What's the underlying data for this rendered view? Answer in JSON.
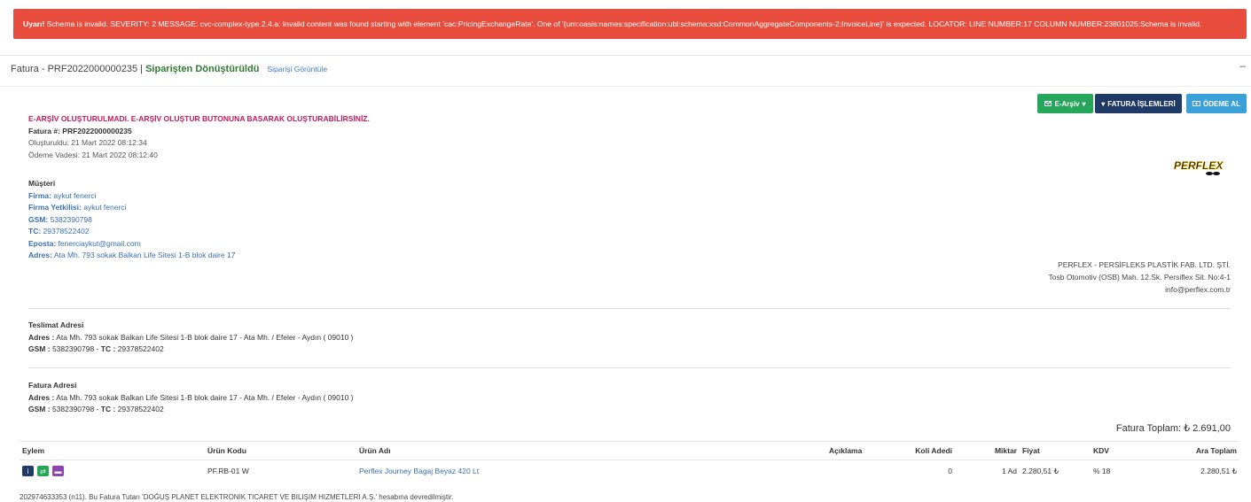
{
  "alert": {
    "prefix": "Uyarı!",
    "message": " Schema is invalid. SEVERITY: 2 MESSAGE: cvc-complex-type.2.4.a: Invalid content was found starting with element 'cac:PricingExchangeRate'. One of '{urn:oasis:names:specification:ubl:schema:xsd:CommonAggregateComponents-2:InvoiceLine}' is expected. LOCATOR: LINE NUMBER:17 COLUMN NUMBER:23801025:Schema is invalid.",
    "close": "×"
  },
  "header": {
    "title": "Fatura - PRF2022000000235 |",
    "status": "Siparişten Dönüştürüldü",
    "link": "Siparişi Görüntüle",
    "collapse": "–"
  },
  "buttons": {
    "earsiv": "E-Arşiv",
    "fatura_islemleri": "FATURA İŞLEMLERİ",
    "odeme_al": "ÖDEME AL"
  },
  "invoice": {
    "warning": "E-ARŞİV OLUŞTURULMADI. E-ARŞİV OLUŞTUR BUTONUNA BASARAK OLUŞTURABİLİRSİNİZ.",
    "number_label": "Fatura #:",
    "number": "PRF2022000000235",
    "created": "Oluşturuldu: 21 Mart 2022 08:12:34",
    "due": "Ödeme Vadesi: 21 Mart 2022 08:12:40"
  },
  "customer": {
    "heading": "Müşteri",
    "firma_label": "Firma:",
    "firma": "aykut fenerci",
    "yetkili_label": "Firma Yetkilisi:",
    "yetkili": "aykut fenerci",
    "gsm_label": "GSM:",
    "gsm": "5382390798",
    "tc_label": "TC:",
    "tc": "29378522402",
    "eposta_label": "Eposta:",
    "eposta": "fenerciaykut@gmail.com",
    "adres_label": "Adres:",
    "adres": "Ata Mh. 793 sokak Balkan Life Sitesi 1-B blok daire 17"
  },
  "logo_text": "PERFLEX",
  "company": {
    "name": "PERFLEX - PERSİFLEKS PLASTİK FAB. LTD. ŞTİ.",
    "address": "Tosb Otomotiv (OSB) Mah. 12.Sk. Persiflex Sit. No:4-1",
    "email": "info@perflex.com.tr"
  },
  "delivery": {
    "heading": "Teslimat Adresi",
    "adres_label": "Adres :",
    "adres": "Ata Mh. 793 sokak Balkan Life Sitesi 1-B blok daire 17 - Ata Mh. / Efeler - Aydın ( 09010 )",
    "gsm_label": "GSM :",
    "gsm": "5382390798 -",
    "tc_label": "TC :",
    "tc": "29378522402"
  },
  "billing": {
    "heading": "Fatura Adresi",
    "adres_label": "Adres :",
    "adres": "Ata Mh. 793 sokak Balkan Life Sitesi 1-B blok daire 17 - Ata Mh. / Efeler - Aydın ( 09010 )",
    "gsm_label": "GSM :",
    "gsm": "5382390798 -",
    "tc_label": "TC :",
    "tc": "29378522402"
  },
  "total": {
    "label": "Fatura Toplam:",
    "value": "₺ 2.691,00"
  },
  "table": {
    "headers": [
      "Eylem",
      "Ürün Kodu",
      "Ürün Adı",
      "Açıklama",
      "Koli Adedi",
      "Miktar",
      "Fiyat",
      "KDV",
      "Ara Toplam"
    ],
    "row": {
      "kod": "PF.RB-01 W",
      "ad": "Perflex Journey Bagaj Beyaz 420 Lt",
      "aciklama": "",
      "koli": "0",
      "miktar": "1 Ad",
      "fiyat": "2.280,51 ₺",
      "kdv": "% 18",
      "ara_toplam": "2.280,51 ₺"
    }
  },
  "footer": "202974633353 (n11). Bu Fatura Tutarı 'DOĞUŞ PLANET ELEKTRONIK TICARET VE BILIŞIM HIZMETLERI A.Ş.' hesabına devredilmiştir.",
  "icons": {
    "info": "info-icon",
    "transfer": "arrows-icon",
    "card": "card-icon",
    "cash": "money-icon",
    "close": "close-icon",
    "logo": "perflex-logo"
  },
  "colors": {
    "alert": "#e74c3c",
    "green": "#26a65b",
    "navy": "#1f3a66",
    "blue": "#3ba0d8",
    "warning": "#c2185b",
    "label": "#3a6fb0"
  }
}
